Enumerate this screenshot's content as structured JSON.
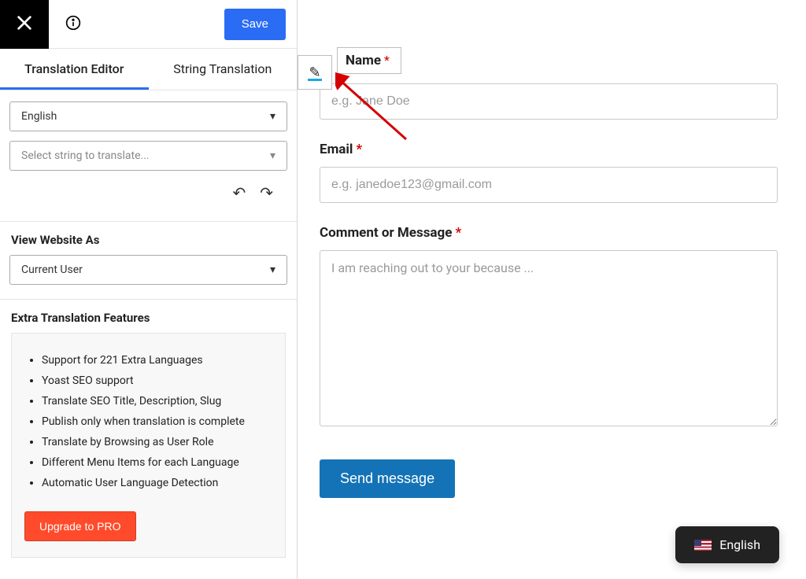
{
  "topbar": {
    "save_label": "Save"
  },
  "tabs": {
    "translation_editor": "Translation Editor",
    "string_translation": "String Translation"
  },
  "editor": {
    "language_selected": "English",
    "string_select_placeholder": "Select string to translate..."
  },
  "view_as": {
    "heading": "View Website As",
    "selected": "Current User"
  },
  "features": {
    "heading": "Extra Translation Features",
    "items": [
      "Support for 221 Extra Languages",
      "Yoast SEO support",
      "Translate SEO Title, Description, Slug",
      "Publish only when translation is complete",
      "Translate by Browsing as User Role",
      "Different Menu Items for each Language",
      "Automatic User Language Detection"
    ],
    "upgrade_label": "Upgrade to PRO"
  },
  "form": {
    "name_label": "Name",
    "name_placeholder": "e.g. Jane Doe",
    "email_label": "Email",
    "email_placeholder": "e.g. janedoe123@gmail.com",
    "message_label": "Comment or Message",
    "message_placeholder": "I am reaching out to your because ...",
    "send_label": "Send message"
  },
  "lang_switch": {
    "label": "English"
  }
}
